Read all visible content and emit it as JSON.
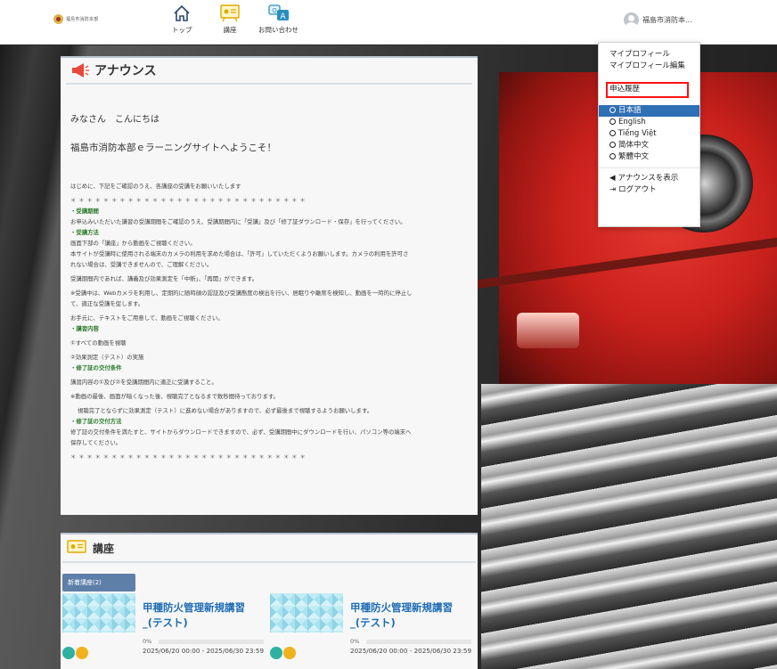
{
  "header": {
    "logo_text": "福島市消防本部",
    "nav": [
      {
        "label": "トップ",
        "icon": "home-icon"
      },
      {
        "label": "講座",
        "icon": "lecture-icon"
      },
      {
        "label": "お問い合わせ",
        "icon": "contact-icon"
      }
    ],
    "user_name": "福島市消防本..."
  },
  "menu": {
    "items": [
      {
        "label": "マイプロフィール"
      },
      {
        "label": "マイプロフィール編集"
      },
      {
        "label": "申込履歴"
      },
      {
        "label": "日本語"
      },
      {
        "label": "English"
      },
      {
        "label": "Tiếng Việt"
      },
      {
        "label": "简体中文"
      },
      {
        "label": "繁體中文"
      },
      {
        "label": "アナウンスを表示"
      },
      {
        "label": "ログアウト"
      }
    ],
    "highlighted": "申込履歴",
    "selected_language": "日本語"
  },
  "announce": {
    "title": "アナウンス",
    "greeting": "みなさん　こんにちは",
    "welcome": "福島市消防本部ｅラーニングサイトへようこそ！",
    "intro": "はじめに、下記をご確認のうえ、各講座の受講をお願いいたします",
    "stars": "＊＊＊＊＊＊＊＊＊＊＊＊＊＊＊＊＊＊＊＊＊＊＊＊＊＊＊＊＊",
    "h1": "・受講期間",
    "p1": "お申込みいただいた講習の受講期間をご確認のうえ、受講期間内に「受講」及び「修了証ダウンロード・保存」を行ってください。",
    "h2": "・受講方法",
    "p2a": "画面下部の「講座」から動画をご視聴ください。",
    "p2b": "本サイトが受講時に使用される端末のカメラの利用を求めた場合は、「許可」していただくようお願いします。カメラの利用を許可さ",
    "p2c": "れない場合は、受講できませんので、ご理解ください。",
    "p2d": "受講期間内であれば、講義及び効果測定を「中断」、「再開」ができます。",
    "p2e": "※受講中は、Webカメラを利用し、定期的に随時顔の認証及び受講態度の検出を行い、居眠りや離席を検知し、動画を一時的に停止し",
    "p2f": "て、適正な受講を促します。",
    "p2g": "お手元に、テキストをご用意して、動画をご視聴ください。",
    "h3": "・講習内容",
    "p3a": "①すべての動画を視聴",
    "p3b": "②効果測定（テスト）の実施",
    "h4": "・修了証の交付条件",
    "p4a": "講習内容の①及び②を受講期間内に適正に受講すること。",
    "p4b": "※動画の最後、画面が暗くなった後、視聴完了となるまで数秒間待っております。",
    "p4c": "視聴完了とならずに効果測定（テスト）に進めない場合がありますので、必ず最後まで視聴するようお願いします。",
    "h5": "・修了証の交付方法",
    "p5a": "修了証の交付条件を満たすと、サイトからダウンロードできますので、必ず、受講期間中にダウンロードを行い、パソコン等の端末へ",
    "p5b": "保存してください。",
    "stars2": "＊＊＊＊＊＊＊＊＊＊＊＊＊＊＊＊＊＊＊＊＊＊＊＊＊＊＊＊＊"
  },
  "courses": {
    "title": "講座",
    "badge": "新着講座(2)",
    "cards": [
      {
        "title": "甲種防火管理新規講習_(テスト)",
        "progress": "0%",
        "progress_value": 0,
        "period": "2025/06/20 00:00 - 2025/06/30 23:59"
      },
      {
        "title": "甲種防火管理新規講習_(テスト)",
        "progress": "0%",
        "progress_value": 0,
        "period": "2025/06/20 00:00 - 2025/06/30 23:59"
      }
    ]
  },
  "colors": {
    "accent": "#2f6fb4",
    "highlight_box": "#ff1111",
    "course_link": "#1f6db5",
    "section_head": "#2b7a2b"
  }
}
